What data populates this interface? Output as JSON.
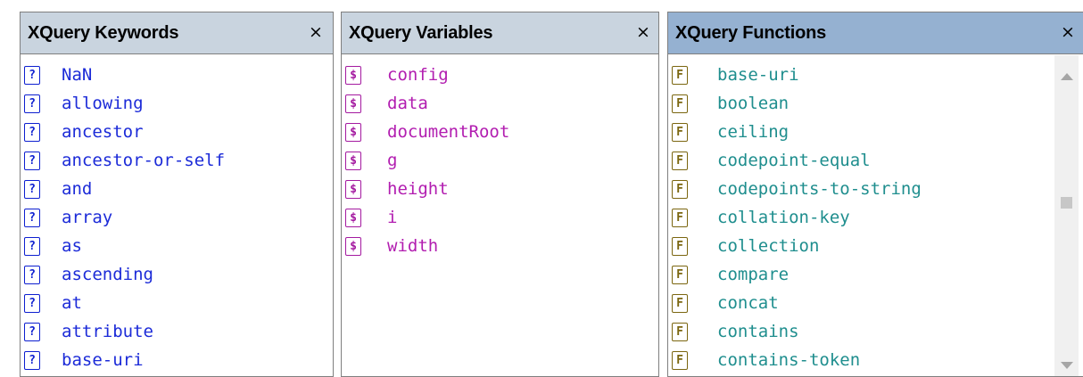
{
  "panels": {
    "keywords": {
      "title": "XQuery Keywords",
      "close": "×",
      "icon_glyph": "?",
      "items": [
        "NaN",
        "allowing",
        "ancestor",
        "ancestor-or-self",
        "and",
        "array",
        "as",
        "ascending",
        "at",
        "attribute",
        "base-uri"
      ]
    },
    "variables": {
      "title": "XQuery Variables",
      "close": "×",
      "icon_glyph": "$",
      "items": [
        "config",
        "data",
        "documentRoot",
        "g",
        "height",
        "i",
        "width"
      ]
    },
    "functions": {
      "title": "XQuery Functions",
      "close": "×",
      "icon_glyph": "F",
      "items": [
        "base-uri",
        "boolean",
        "ceiling",
        "codepoint-equal",
        "codepoints-to-string",
        "collation-key",
        "collection",
        "compare",
        "concat",
        "contains",
        "contains-token"
      ]
    }
  },
  "colors": {
    "keyword": "#1c2bd8",
    "variable": "#b21db0",
    "function_text": "#1f8e8e",
    "function_icon": "#7b6610",
    "header_inactive": "#c9d4df",
    "header_active": "#95b1d1"
  },
  "icons": {
    "keyword": "keyword-icon",
    "variable": "variable-icon",
    "function": "function-icon",
    "close": "close-icon",
    "scroll_up": "scroll-up-icon",
    "scroll_down": "scroll-down-icon"
  }
}
